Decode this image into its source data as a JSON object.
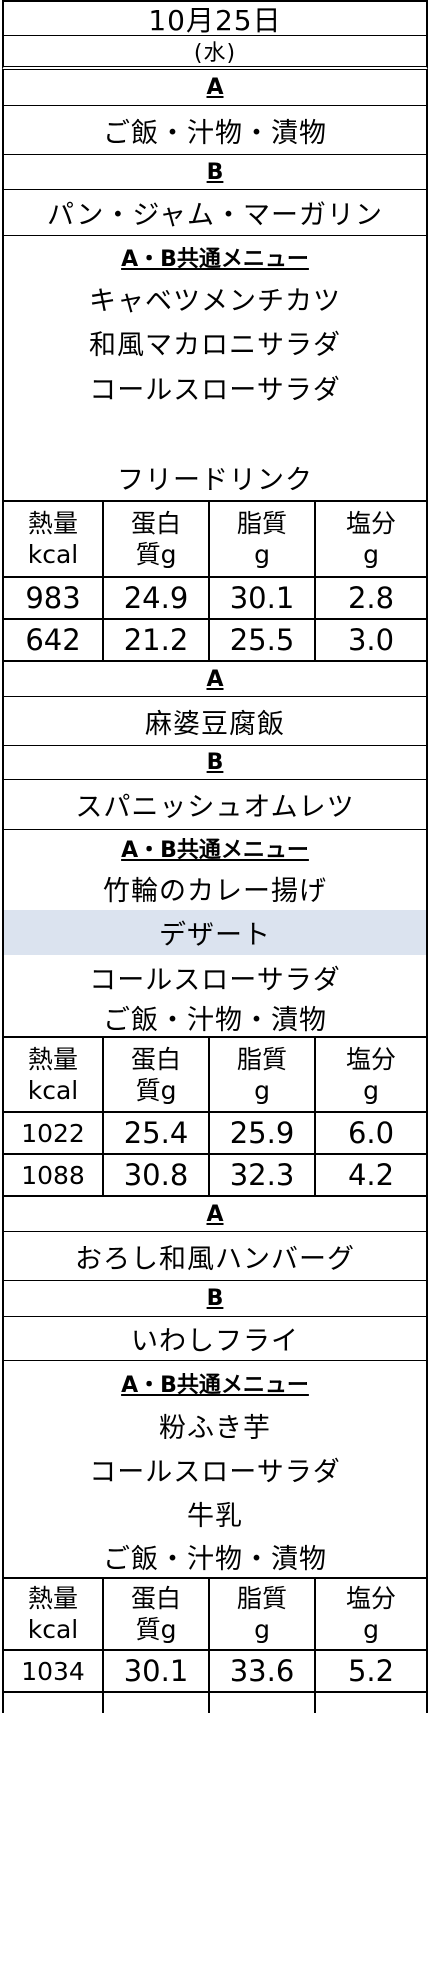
{
  "header": {
    "date": "10月25日",
    "weekday": "(水)"
  },
  "nutrition_headers": [
    {
      "line1": "熱量",
      "line2": "kcal"
    },
    {
      "line1": "蛋白",
      "line2": "質g"
    },
    {
      "line1": "脂質",
      "line2": "g"
    },
    {
      "line1": "塩分",
      "line2": "g"
    }
  ],
  "sections": [
    {
      "a_label": "A",
      "a_item": "ご飯・汁物・漬物",
      "b_label": "B",
      "b_item": "パン・ジャム・マーガリン",
      "common_label": "A・B共通メニュー",
      "common_items": [
        "キャベツメンチカツ",
        "和風マカロニサラダ",
        "コールスローサラダ",
        "",
        "フリードリンク"
      ],
      "rows": [
        [
          "983",
          "24.9",
          "30.1",
          "2.8"
        ],
        [
          "642",
          "21.2",
          "25.5",
          "3.0"
        ]
      ]
    },
    {
      "a_label": "A",
      "a_item": "麻婆豆腐飯",
      "b_label": "B",
      "b_item": "スパニッシュオムレツ",
      "common_label": "A・B共通メニュー",
      "common_items": [
        "竹輪のカレー揚げ",
        "デザート",
        "コールスローサラダ",
        "ご飯・汁物・漬物"
      ],
      "rows": [
        [
          "1022",
          "25.4",
          "25.9",
          "6.0"
        ],
        [
          "1088",
          "30.8",
          "32.3",
          "4.2"
        ]
      ]
    },
    {
      "a_label": "A",
      "a_item": "おろし和風ハンバーグ",
      "b_label": "B",
      "b_item": "いわしフライ",
      "common_label": "A・B共通メニュー",
      "common_items": [
        "粉ふき芋",
        "コールスローサラダ",
        "牛乳",
        "ご飯・汁物・漬物"
      ],
      "rows": [
        [
          "1034",
          "30.1",
          "33.6",
          "5.2"
        ]
      ]
    }
  ]
}
